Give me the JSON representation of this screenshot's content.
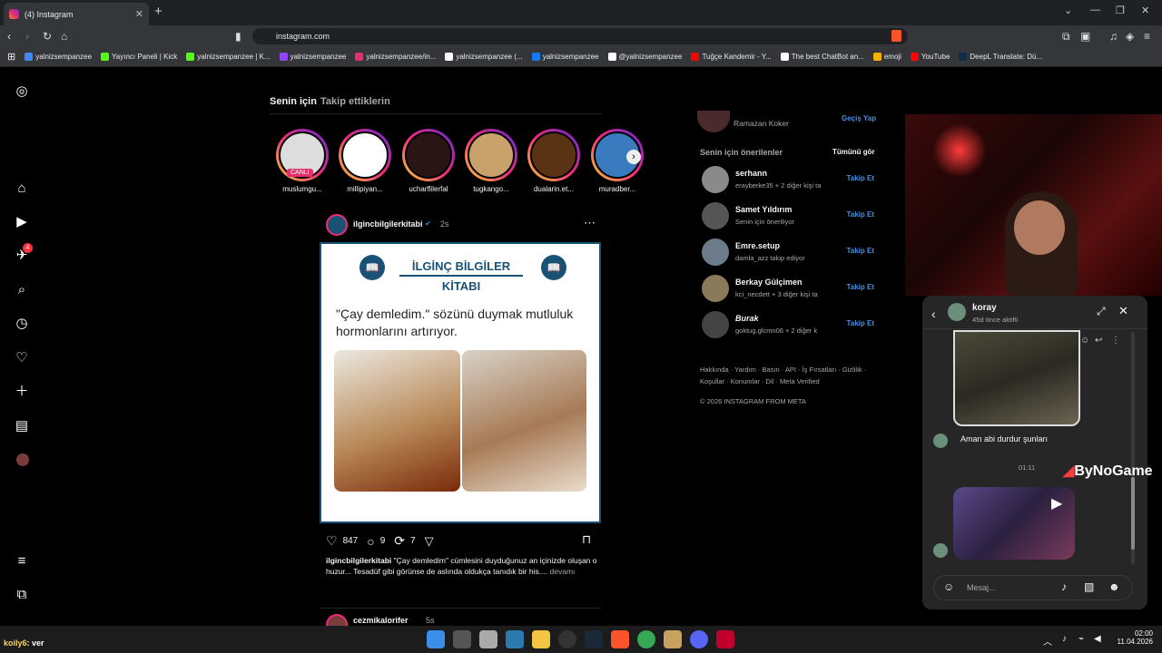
{
  "browser": {
    "tab_title": "(4) Instagram",
    "new_tab": "+",
    "url": "instagram.com",
    "bookmarks": [
      {
        "label": "yalnizsempanzee",
        "color": "#4285f4"
      },
      {
        "label": "Yayıncı Paneli | Kick",
        "color": "#53fc18"
      },
      {
        "label": "yalnizsempanzee | K...",
        "color": "#53fc18"
      },
      {
        "label": "yalnizsempanzee",
        "color": "#9146ff"
      },
      {
        "label": "yalnizsempanzee/in...",
        "color": "#e1306c"
      },
      {
        "label": "yalnizsempanzee (...",
        "color": "#ffffff"
      },
      {
        "label": "yalnizsempanzee",
        "color": "#1877f2"
      },
      {
        "label": "@yalnizsempanzee",
        "color": "#ffffff"
      },
      {
        "label": "Tuğçe Kandemir - Y...",
        "color": "#ff0000"
      },
      {
        "label": "The best ChatBot an...",
        "color": "#ffffff"
      },
      {
        "label": "emoji",
        "color": "#f4b400"
      },
      {
        "label": "YouTube",
        "color": "#ff0000"
      },
      {
        "label": "DeepL Translate: Dü...",
        "color": "#0f2b46"
      }
    ]
  },
  "sidebar": {
    "notification_count": "4"
  },
  "feed": {
    "tabs": [
      "Senin için",
      "Takip ettiklerin"
    ],
    "stories": [
      {
        "name": "muslumgu...",
        "live": "CANLI"
      },
      {
        "name": "millipiyan...",
        "live": ""
      },
      {
        "name": "ucharflilerfal",
        "live": ""
      },
      {
        "name": "tugkango...",
        "live": ""
      },
      {
        "name": "dualarin.et...",
        "live": ""
      },
      {
        "name": "muradber...",
        "live": ""
      }
    ],
    "post": {
      "author": "ilgincbilgilerkitabi",
      "time": "2s",
      "card_title": "İLGİNÇ BİLGİLER KİTABI",
      "card_text": "\"Çay demledim.\" sözünü duymak mutluluk hormonlarını artırıyor.",
      "likes": "847",
      "comments": "9",
      "reposts": "7",
      "caption_user": "ilgincbilgilerkitabi",
      "caption_text": "\"Çay demledim\" cümlesini duyduğunuz an içinizde oluşan o huzur... Tesadüf gibi görünse de aslında oldukça tanıdık bir his....",
      "more": "devamı"
    },
    "next_post": {
      "author": "cezmikalorifer",
      "time": "5s"
    }
  },
  "right": {
    "top_user_sub": "Ramazan Koker",
    "switch": "Geçiş Yap",
    "suggestions_title": "Senin için önerilenler",
    "see_all": "Tümünü gör",
    "follow_label": "Takip Et",
    "suggestions": [
      {
        "name": "serhann",
        "sub": "erayberke35 + 2 diğer kişi ta"
      },
      {
        "name": "Samet Yıldırım",
        "sub": "Senin için öneriliyor"
      },
      {
        "name": "Emre.setup",
        "sub": "damla_azz takip ediyor"
      },
      {
        "name": "Berkay Gülçimen",
        "sub": "kci_necdett + 3 diğer kişi ta"
      },
      {
        "name": "Burak",
        "sub": "goktug.glcmn06 + 2 diğer k"
      }
    ],
    "footer_links": "Hakkında · Yardım · Basın · API · İş Fırsatları · Gizlilik · Koşullar · Konumlar · Dil · Meta Verified",
    "copyright": "© 2026 INSTAGRAM FROM META"
  },
  "chat": {
    "name": "koray",
    "status": "45d önce aktifti",
    "message": "Aman abi durdur şunları",
    "time": "01:11",
    "placeholder": "Mesaj..."
  },
  "overlay": {
    "brand": "ByNoGame",
    "viewer": "koily6",
    "viewer_msg": ": ver"
  },
  "taskbar": {
    "time": "02:00",
    "date": "11.04.2026"
  }
}
